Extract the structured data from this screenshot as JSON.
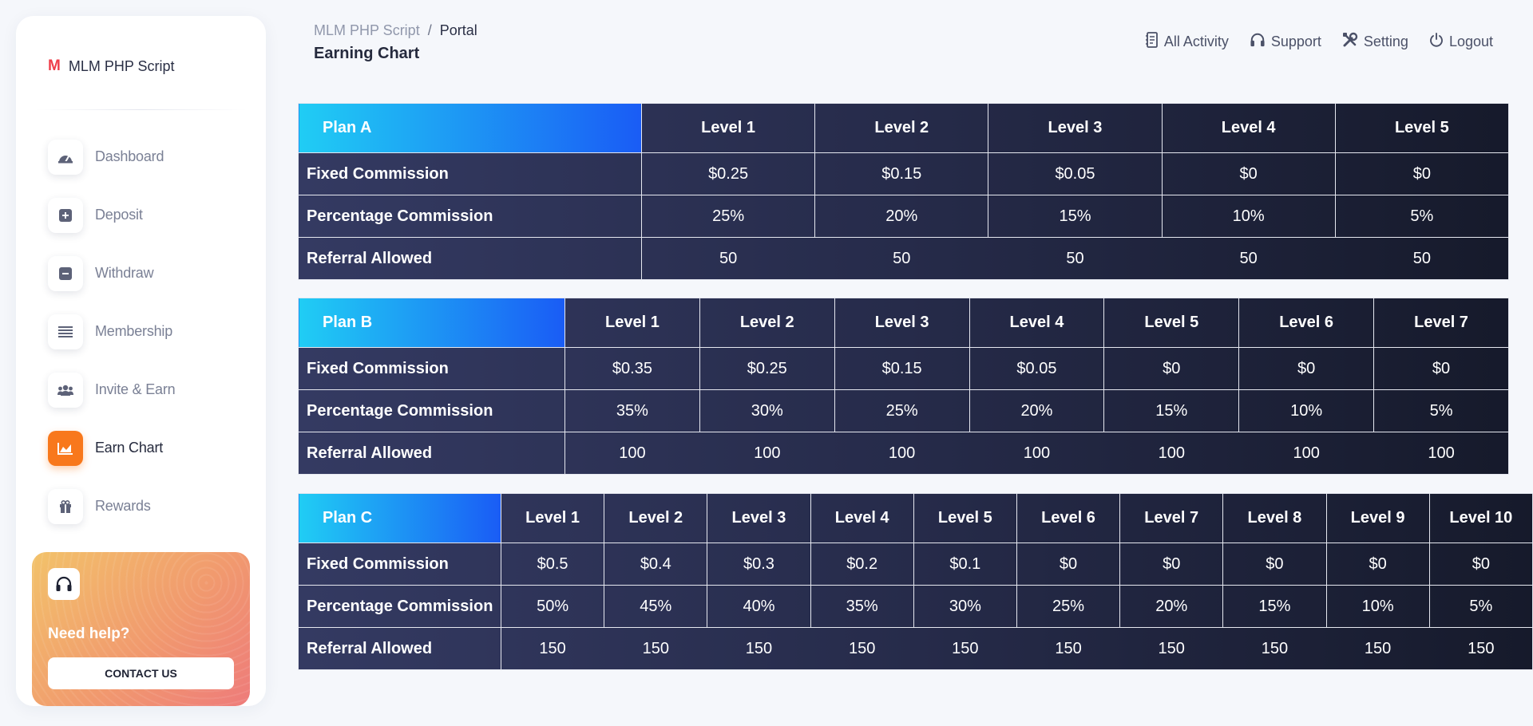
{
  "brand": {
    "logo": "M",
    "name": "MLM PHP Script"
  },
  "nav": [
    {
      "label": "Dashboard",
      "icon": "dashboard-icon",
      "active": false
    },
    {
      "label": "Deposit",
      "icon": "plus-square-icon",
      "active": false
    },
    {
      "label": "Withdraw",
      "icon": "minus-square-icon",
      "active": false
    },
    {
      "label": "Membership",
      "icon": "list-icon",
      "active": false
    },
    {
      "label": "Invite & Earn",
      "icon": "users-icon",
      "active": false
    },
    {
      "label": "Earn Chart",
      "icon": "area-chart-icon",
      "active": true
    },
    {
      "label": "Rewards",
      "icon": "gift-icon",
      "active": false
    }
  ],
  "help": {
    "title": "Need help?",
    "button": "CONTACT US",
    "icon": "headphones-icon"
  },
  "breadcrumb": {
    "root": "MLM PHP Script",
    "separator": "/",
    "current": "Portal"
  },
  "page_title": "Earning Chart",
  "top_actions": [
    {
      "label": "All Activity",
      "icon": "activity-book-icon"
    },
    {
      "label": "Support",
      "icon": "headphones-icon"
    },
    {
      "label": "Setting",
      "icon": "tools-icon"
    },
    {
      "label": "Logout",
      "icon": "power-icon"
    }
  ],
  "plans": [
    {
      "name": "Plan A",
      "levels": [
        "Level 1",
        "Level 2",
        "Level 3",
        "Level 4",
        "Level 5"
      ],
      "rows": [
        {
          "label": "Fixed Commission",
          "values": [
            "$0.25",
            "$0.15",
            "$0.05",
            "$0",
            "$0"
          ]
        },
        {
          "label": "Percentage Commission",
          "values": [
            "25%",
            "20%",
            "15%",
            "10%",
            "5%"
          ]
        },
        {
          "label": "Referral Allowed",
          "values": [
            "50",
            "50",
            "50",
            "50",
            "50"
          ]
        }
      ]
    },
    {
      "name": "Plan B",
      "levels": [
        "Level 1",
        "Level 2",
        "Level 3",
        "Level 4",
        "Level 5",
        "Level 6",
        "Level 7"
      ],
      "rows": [
        {
          "label": "Fixed Commission",
          "values": [
            "$0.35",
            "$0.25",
            "$0.15",
            "$0.05",
            "$0",
            "$0",
            "$0"
          ]
        },
        {
          "label": "Percentage Commission",
          "values": [
            "35%",
            "30%",
            "25%",
            "20%",
            "15%",
            "10%",
            "5%"
          ]
        },
        {
          "label": "Referral Allowed",
          "values": [
            "100",
            "100",
            "100",
            "100",
            "100",
            "100",
            "100"
          ]
        }
      ]
    },
    {
      "name": "Plan C",
      "levels": [
        "Level 1",
        "Level 2",
        "Level 3",
        "Level 4",
        "Level 5",
        "Level 6",
        "Level 7",
        "Level 8",
        "Level 9",
        "Level 10"
      ],
      "rows": [
        {
          "label": "Fixed Commission",
          "values": [
            "$0.5",
            "$0.4",
            "$0.3",
            "$0.2",
            "$0.1",
            "$0",
            "$0",
            "$0",
            "$0",
            "$0"
          ]
        },
        {
          "label": "Percentage Commission",
          "values": [
            "50%",
            "45%",
            "40%",
            "35%",
            "30%",
            "25%",
            "20%",
            "15%",
            "10%",
            "5%"
          ]
        },
        {
          "label": "Referral Allowed",
          "values": [
            "150",
            "150",
            "150",
            "150",
            "150",
            "150",
            "150",
            "150",
            "150",
            "150"
          ]
        }
      ]
    }
  ]
}
